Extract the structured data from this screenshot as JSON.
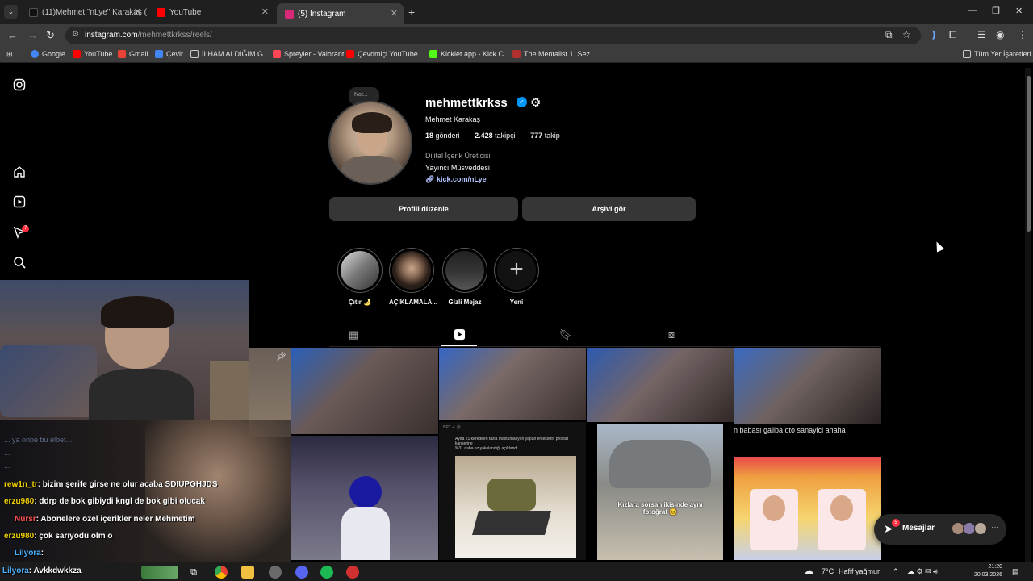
{
  "browser": {
    "tabs": [
      {
        "label": "(11)Mehmet \"nLye\" Karakaş (@",
        "favicon_color": "#111111"
      },
      {
        "label": "YouTube",
        "favicon_color": "#ff0000"
      },
      {
        "label": "(5) Instagram",
        "favicon_color": "#d62976"
      }
    ],
    "new_tab": "+",
    "url_host": "instagram.com",
    "url_path": "/mehmettkrkss/reels/"
  },
  "bookmarks": [
    {
      "label": "Google",
      "color": "#4285f4"
    },
    {
      "label": "YouTube",
      "color": "#ff0000"
    },
    {
      "label": "Gmail",
      "color": "#ea4335"
    },
    {
      "label": "Çevir",
      "color": "#4285f4"
    },
    {
      "label": "İLHAM ALDIĞIM G...",
      "color": "#888888"
    },
    {
      "label": "Spreyler - Valorant",
      "color": "#ff4655"
    },
    {
      "label": "Çevrimiçi YouTube...",
      "color": "#ff0000"
    },
    {
      "label": "Kicklet.app - Kick C...",
      "color": "#53fc18"
    },
    {
      "label": "The Mentalist 1. Sez...",
      "color": "#b03030"
    }
  ],
  "bookmarks_folder": "Tüm Yer İşaretleri",
  "sidebar": {
    "notifications_count": "7"
  },
  "profile": {
    "note": "Not...",
    "username": "mehmettkrkss",
    "full_name": "Mehmet Karakaş",
    "posts_count": "18",
    "posts_label": "gönderi",
    "followers_count": "2.428",
    "followers_label": "takipçi",
    "following_count": "777",
    "following_label": "takip",
    "category": "Dijital İçerik Üreticisi",
    "bio": "Yayıncı Müsveddesi",
    "link": "kick.com/nLye",
    "edit_button": "Profili düzenle",
    "archive_button": "Arşivi gör"
  },
  "highlights": [
    {
      "label": "Çıtır 🌛"
    },
    {
      "label": "AÇIKLAMALA..."
    },
    {
      "label": "Gizli Mejaz"
    },
    {
      "label": "Yeni"
    }
  ],
  "posts": {
    "car_caption": "Kızlara sorsan ikisinde aynı fotoğraf 😊",
    "banner_text": "n babası galiba oto sanayici ahaha",
    "tweet_header": "BPT ✔ @...",
    "tweet_line1": "Ayda 21 keredeen fazla mastürbasyon yapan erkeklerin prostat kanserine",
    "tweet_line2": "%31 daha az yakalandığı açıklandı."
  },
  "chat": [
    {
      "name": "rew1n_tr",
      "message": ": bizim şerife girse ne olur acaba SDIUPGHJDS"
    },
    {
      "name": "erzu980",
      "message": ": ddrp de bok gibiydi kngl de bok gibi olucak"
    },
    {
      "name": "Nursr",
      "message": ": Abonelere özel içerikler neler Mehmetim"
    },
    {
      "name": "erzu980",
      "message": ": çok sarıyodu olm o"
    },
    {
      "name": "Lilyora",
      "message": ":"
    },
    {
      "name": "Lilyora",
      "message": ": Avkkdwkkza"
    }
  ],
  "messages": {
    "label": "Mesajlar",
    "badge": "5"
  },
  "taskbar": {
    "weather_temp": "7°C",
    "weather_text": "Hafif yağmur",
    "time": "21:20",
    "date": "20.03.2026"
  }
}
